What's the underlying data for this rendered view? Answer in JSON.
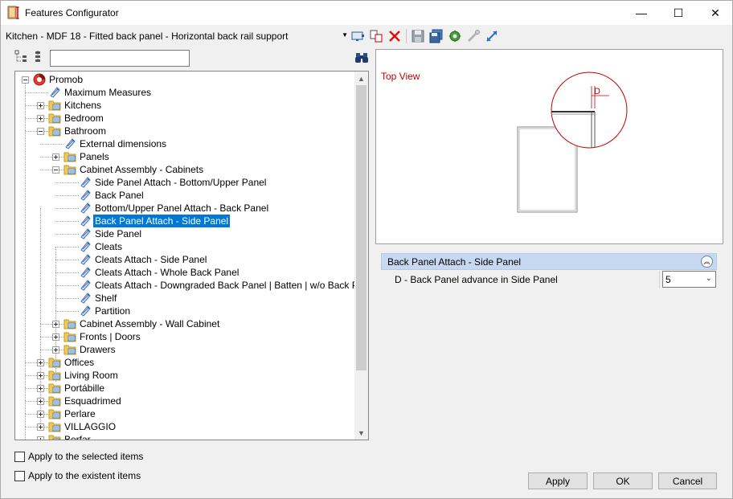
{
  "window": {
    "title": "Features Configurator",
    "controls": {
      "minimize": "—",
      "maximize": "☐",
      "close": "✕"
    }
  },
  "toolbar": {
    "preset": "Kitchen - MDF 18 - Fitted back panel - Horizontal back rail support",
    "icons": [
      "monitor-icon",
      "copy-icon",
      "delete-icon",
      "save-icon",
      "save-all-icon",
      "settings-icon",
      "tools-icon",
      "resize-icon"
    ]
  },
  "tree": {
    "search_value": "",
    "nodes": [
      {
        "label": "Promob",
        "level": 0,
        "expander": "minus",
        "icon": "promob"
      },
      {
        "label": "Maximum Measures",
        "level": 1,
        "expander": "none",
        "icon": "leaf"
      },
      {
        "label": "Kitchens",
        "level": 1,
        "expander": "plus",
        "icon": "folder"
      },
      {
        "label": "Bedroom",
        "level": 1,
        "expander": "plus",
        "icon": "folder"
      },
      {
        "label": "Bathroom",
        "level": 1,
        "expander": "minus",
        "icon": "folder"
      },
      {
        "label": "External dimensions",
        "level": 2,
        "expander": "none",
        "icon": "leaf"
      },
      {
        "label": "Panels",
        "level": 2,
        "expander": "plus",
        "icon": "folder"
      },
      {
        "label": "Cabinet Assembly - Cabinets",
        "level": 2,
        "expander": "minus",
        "icon": "folder"
      },
      {
        "label": "Side Panel Attach - Bottom/Upper Panel",
        "level": 3,
        "expander": "none",
        "icon": "leaf"
      },
      {
        "label": "Back Panel",
        "level": 3,
        "expander": "none",
        "icon": "leaf"
      },
      {
        "label": " Bottom/Upper Panel Attach - Back Panel",
        "level": 3,
        "expander": "none",
        "icon": "leaf"
      },
      {
        "label": "Back Panel Attach - Side Panel",
        "level": 3,
        "expander": "none",
        "icon": "leaf",
        "selected": true
      },
      {
        "label": "Side Panel",
        "level": 3,
        "expander": "none",
        "icon": "leaf"
      },
      {
        "label": "Cleats",
        "level": 3,
        "expander": "none",
        "icon": "leaf"
      },
      {
        "label": "Cleats Attach - Side Panel",
        "level": 3,
        "expander": "none",
        "icon": "leaf"
      },
      {
        "label": "Cleats Attach - Whole Back Panel",
        "level": 3,
        "expander": "none",
        "icon": "leaf"
      },
      {
        "label": "Cleats Attach - Downgraded Back Panel | Batten | w/o Back Panel",
        "level": 3,
        "expander": "none",
        "icon": "leaf"
      },
      {
        "label": "Shelf",
        "level": 3,
        "expander": "none",
        "icon": "leaf"
      },
      {
        "label": "Partition",
        "level": 3,
        "expander": "none",
        "icon": "leaf"
      },
      {
        "label": "Cabinet Assembly - Wall Cabinet",
        "level": 2,
        "expander": "plus",
        "icon": "folder"
      },
      {
        "label": "Fronts | Doors",
        "level": 2,
        "expander": "plus",
        "icon": "folder"
      },
      {
        "label": "Drawers",
        "level": 2,
        "expander": "plus",
        "icon": "folder"
      },
      {
        "label": "Offices",
        "level": 1,
        "expander": "plus",
        "icon": "folder"
      },
      {
        "label": "Living Room",
        "level": 1,
        "expander": "plus",
        "icon": "folder"
      },
      {
        "label": "Portábille",
        "level": 1,
        "expander": "plus",
        "icon": "folder"
      },
      {
        "label": "Esquadrimed",
        "level": 1,
        "expander": "plus",
        "icon": "folder"
      },
      {
        "label": "Perlare",
        "level": 1,
        "expander": "plus",
        "icon": "folder"
      },
      {
        "label": "VILLAGGIO",
        "level": 1,
        "expander": "plus",
        "icon": "folder"
      },
      {
        "label": "Berfar",
        "level": 1,
        "expander": "plus",
        "icon": "folder"
      }
    ]
  },
  "preview": {
    "label": "Top View",
    "dimension_label": "D"
  },
  "properties": {
    "group_title": "Back Panel Attach - Side Panel",
    "collapse_glyph": "︽",
    "rows": [
      {
        "label": "D - Back Panel advance in Side Panel",
        "value": "5"
      }
    ]
  },
  "options": {
    "apply_selected": "Apply to the selected items",
    "apply_existent": "Apply to the existent items"
  },
  "buttons": {
    "apply": "Apply",
    "ok": "OK",
    "cancel": "Cancel"
  },
  "colors": {
    "selection": "#0078d7",
    "props_header": "#c6d9f1",
    "accent_red": "#c00000"
  }
}
